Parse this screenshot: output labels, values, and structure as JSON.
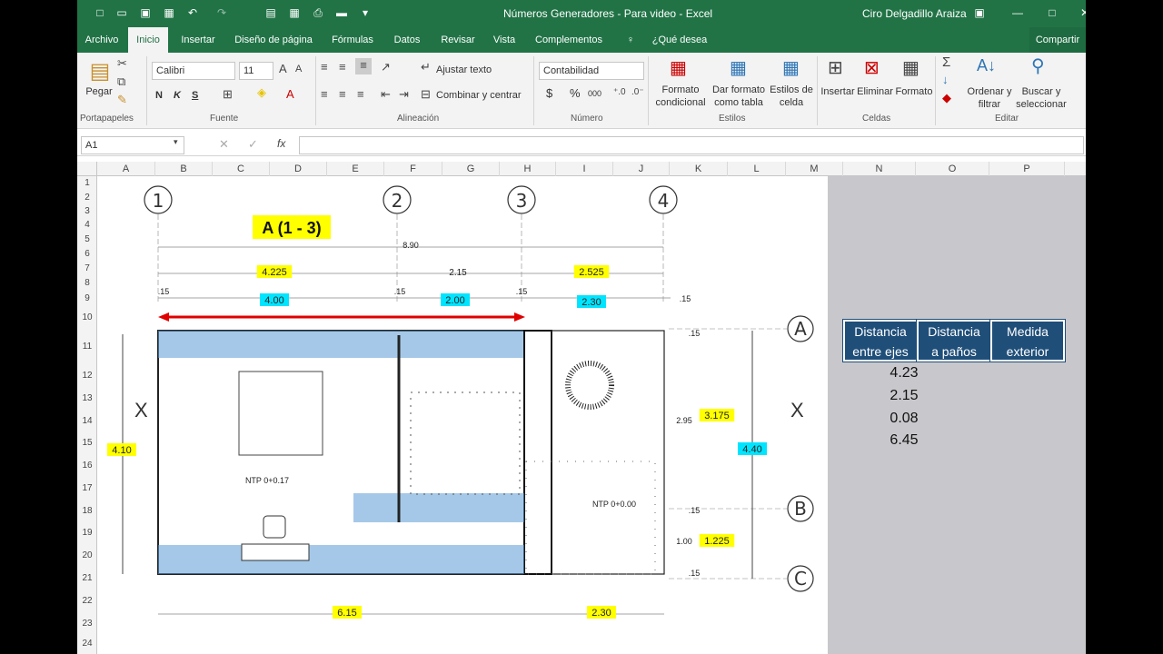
{
  "title": {
    "text": "Números Generadores - Para video - Excel",
    "user": "Ciro Delgadillo Araiza"
  },
  "tabs": [
    "Archivo",
    "Inicio",
    "Insertar",
    "Diseño de página",
    "Fórmulas",
    "Datos",
    "Revisar",
    "Vista",
    "Complementos",
    "¿Qué desea hacer?",
    "Compartir"
  ],
  "ribbon": {
    "clipboard": {
      "paste": "Pegar",
      "group": "Portapapeles"
    },
    "font": {
      "name": "Calibri",
      "size": "11",
      "bold": "N",
      "italic": "K",
      "underline": "S",
      "group": "Fuente"
    },
    "alignment": {
      "wrap": "Ajustar texto",
      "merge": "Combinar y centrar",
      "group": "Alineación"
    },
    "number": {
      "format": "Contabilidad",
      "currency": "$",
      "percent": "%",
      "thousands": "000",
      "group": "Número"
    },
    "styles": {
      "conditional1": "Formato",
      "conditional2": "condicional",
      "table1": "Dar formato",
      "table2": "como tabla",
      "cell1": "Estilos de",
      "cell2": "celda",
      "group": "Estilos"
    },
    "cells": {
      "insert": "Insertar",
      "delete": "Eliminar",
      "format": "Formato",
      "group": "Celdas"
    },
    "editing": {
      "sort1": "Ordenar y",
      "sort2": "filtrar",
      "find1": "Buscar y",
      "find2": "seleccionar",
      "group": "Editar"
    }
  },
  "formula_bar": {
    "name_box": "A1",
    "fx": "fx",
    "content": ""
  },
  "columns": [
    "A",
    "B",
    "C",
    "D",
    "E",
    "F",
    "G",
    "H",
    "I",
    "J",
    "K",
    "L",
    "M",
    "N",
    "O",
    "P"
  ],
  "rows": [
    "1",
    "2",
    "3",
    "4",
    "5",
    "6",
    "7",
    "8",
    "9",
    "10",
    "11",
    "12",
    "13",
    "14",
    "15",
    "16",
    "17",
    "18",
    "19",
    "20",
    "21",
    "22",
    "23",
    "24"
  ],
  "table": {
    "headers": [
      [
        "Distancia",
        "entre ejes"
      ],
      [
        "Distancia",
        "a paños"
      ],
      [
        "Medida",
        "exterior"
      ]
    ],
    "values": [
      "4.23",
      "2.15",
      "0.08",
      "6.45"
    ]
  },
  "plan": {
    "title": "A (1 - 3)",
    "axes": [
      "1",
      "2",
      "3",
      "4"
    ],
    "row_axes": [
      "A",
      "B",
      "C"
    ],
    "dims": {
      "total": "8.90",
      "d1": "4.225",
      "d2": "2.15",
      "d3": "2.525",
      "m1": "4.00",
      "m2": "2.00",
      "m3": "2.30",
      "gap": ".15",
      "left": "4.10",
      "right1": "2.95",
      "right2": "3.175",
      "right3": "4.40",
      "right4": "1.00",
      "right5": "1.225",
      "bottom1": "6.15",
      "bottom2": "2.30"
    },
    "labels": {
      "ntp1": "NTP 0+0.17",
      "ntp2": "NTP 0+0.00",
      "x": "X"
    }
  },
  "colors": {
    "brand": "#217346",
    "header_fill": "#1f4e79",
    "yellow": "#ffff00",
    "cyan": "#00e5ff",
    "wall_fill": "#5b9bd5",
    "arrow": "#e00000"
  }
}
